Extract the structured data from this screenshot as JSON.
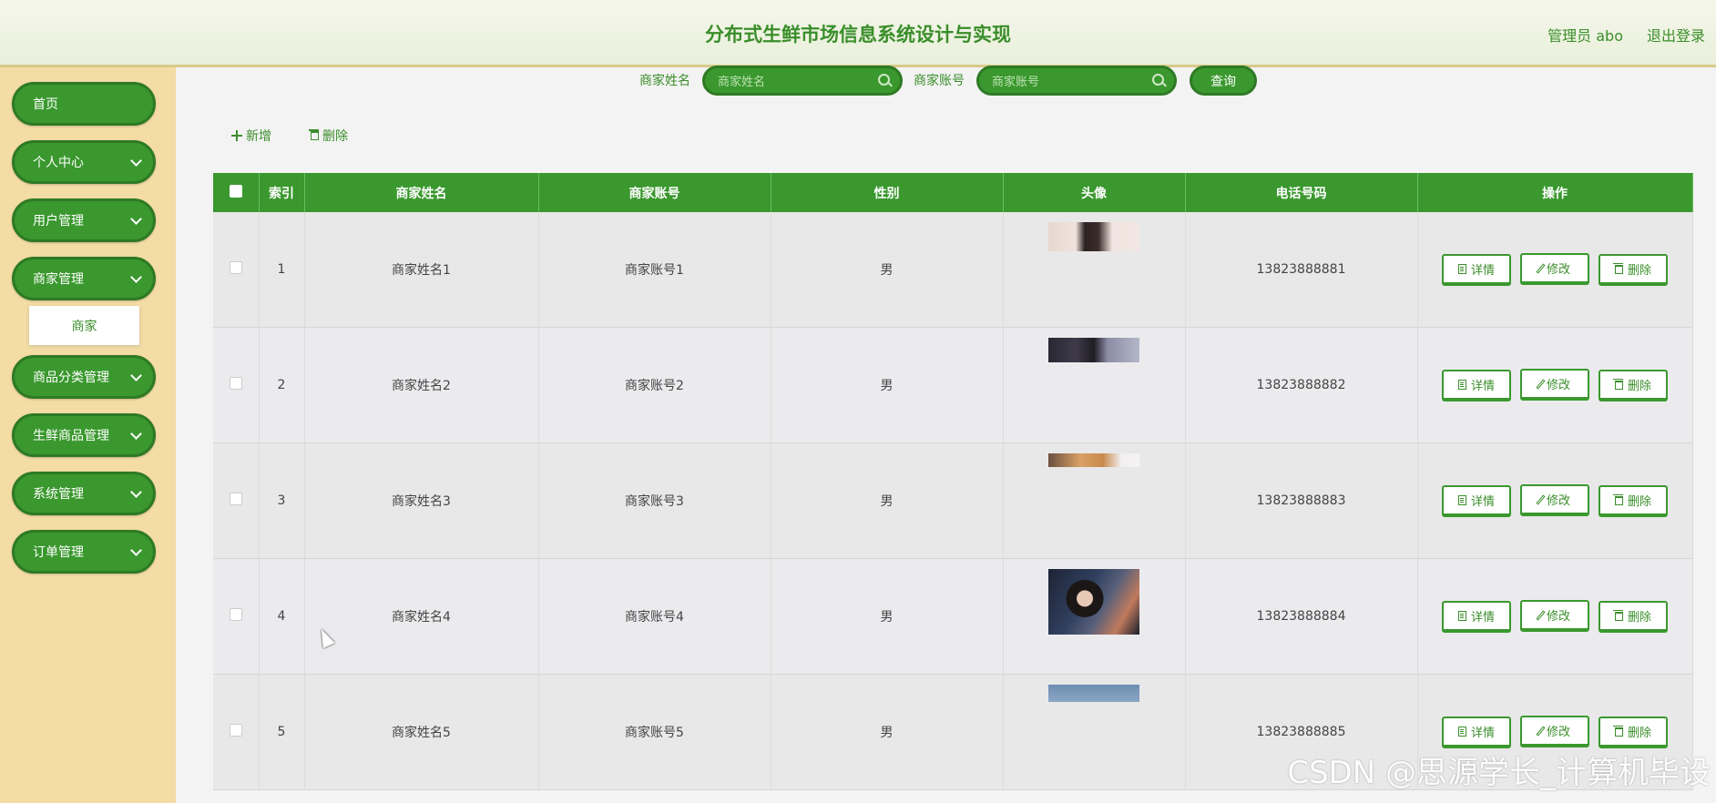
{
  "header": {
    "title": "分布式生鲜市场信息系统设计与实现",
    "user_label": "管理员 abo",
    "logout_label": "退出登录"
  },
  "sidebar": {
    "items": [
      {
        "label": "首页",
        "has_arrow": false
      },
      {
        "label": "个人中心",
        "has_arrow": true
      },
      {
        "label": "用户管理",
        "has_arrow": true
      },
      {
        "label": "商家管理",
        "has_arrow": true
      },
      {
        "label": "商品分类管理",
        "has_arrow": true
      },
      {
        "label": "生鲜商品管理",
        "has_arrow": true
      },
      {
        "label": "系统管理",
        "has_arrow": true
      },
      {
        "label": "订单管理",
        "has_arrow": true
      }
    ],
    "submenu": {
      "label": "商家"
    }
  },
  "search": {
    "name_label": "商家姓名",
    "name_placeholder": "商家姓名",
    "account_label": "商家账号",
    "account_placeholder": "商家账号",
    "query_label": "查询"
  },
  "toolbar": {
    "add_label": "新增",
    "delete_label": "删除"
  },
  "table": {
    "headers": [
      "索引",
      "商家姓名",
      "商家账号",
      "性别",
      "头像",
      "电话号码",
      "操作"
    ],
    "rows": [
      {
        "index": "1",
        "name": "商家姓名1",
        "account": "商家账号1",
        "gender": "男",
        "phone": "13823888881"
      },
      {
        "index": "2",
        "name": "商家姓名2",
        "account": "商家账号2",
        "gender": "男",
        "phone": "13823888882"
      },
      {
        "index": "3",
        "name": "商家姓名3",
        "account": "商家账号3",
        "gender": "男",
        "phone": "13823888883"
      },
      {
        "index": "4",
        "name": "商家姓名4",
        "account": "商家账号4",
        "gender": "男",
        "phone": "13823888884"
      },
      {
        "index": "5",
        "name": "商家姓名5",
        "account": "商家账号5",
        "gender": "男",
        "phone": "13823888885"
      }
    ],
    "actions": {
      "detail": "详情",
      "edit": "修改",
      "delete": "删除"
    }
  },
  "watermark": "CSDN @思源学长_计算机毕设",
  "colors": {
    "primary": "#3a982e",
    "sidebar_bg": "#f4dca5",
    "text_green": "#3a8e2a"
  }
}
